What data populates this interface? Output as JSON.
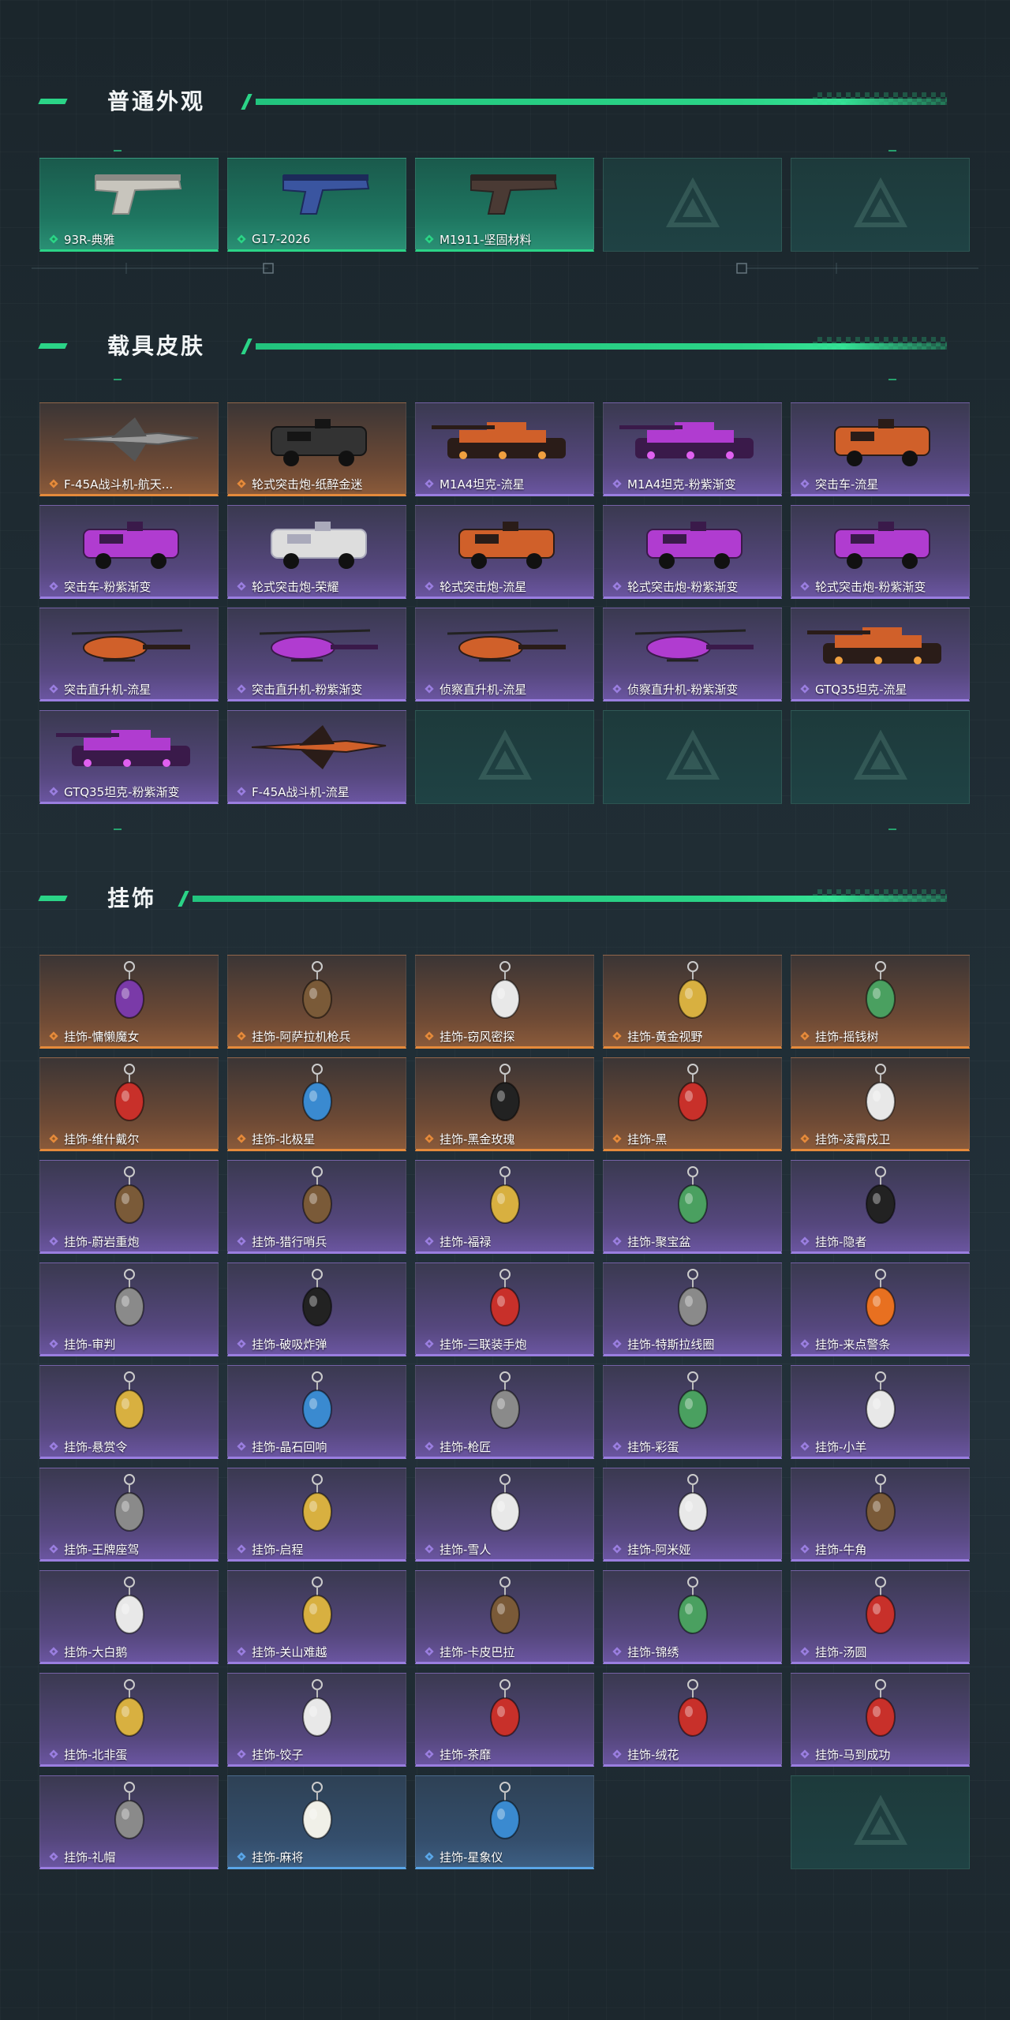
{
  "sections": {
    "weapons": {
      "title": "普通外观",
      "items": [
        {
          "label": "93R-典雅",
          "quality": "green",
          "art": "pistol-silver"
        },
        {
          "label": "G17-2026",
          "quality": "green",
          "art": "pistol-blue"
        },
        {
          "label": "M1911-坚固材料",
          "quality": "green",
          "art": "pistol-dark"
        },
        {
          "label": "",
          "quality": "empty"
        },
        {
          "label": "",
          "quality": "empty"
        }
      ]
    },
    "vehicles": {
      "title": "载具皮肤",
      "items": [
        {
          "label": "F-45A战斗机-航天...",
          "quality": "orange",
          "art": "jet-grey"
        },
        {
          "label": "轮式突击炮-纸醉金迷",
          "quality": "orange",
          "art": "apc-black"
        },
        {
          "label": "M1A4坦克-流星",
          "quality": "purple",
          "art": "tank-lava"
        },
        {
          "label": "M1A4坦克-粉紫渐变",
          "quality": "purple",
          "art": "tank-purple"
        },
        {
          "label": "突击车-流星",
          "quality": "purple",
          "art": "truck-lava"
        },
        {
          "label": "突击车-粉紫渐变",
          "quality": "purple",
          "art": "truck-purple"
        },
        {
          "label": "轮式突击炮-荣耀",
          "quality": "purple",
          "art": "apc-white"
        },
        {
          "label": "轮式突击炮-流星",
          "quality": "purple",
          "art": "apc-lava"
        },
        {
          "label": "轮式突击炮-粉紫渐变",
          "quality": "purple",
          "art": "apc-purple"
        },
        {
          "label": "轮式突击炮-粉紫渐变",
          "quality": "purple",
          "art": "apc-purple"
        },
        {
          "label": "突击直升机-流星",
          "quality": "purple",
          "art": "heli-lava"
        },
        {
          "label": "突击直升机-粉紫渐变",
          "quality": "purple",
          "art": "heli-purple"
        },
        {
          "label": "侦察直升机-流星",
          "quality": "purple",
          "art": "scout-lava"
        },
        {
          "label": "侦察直升机-粉紫渐变",
          "quality": "purple",
          "art": "scout-purple"
        },
        {
          "label": "GTQ35坦克-流星",
          "quality": "purple",
          "art": "tank-lava"
        },
        {
          "label": "GTQ35坦克-粉紫渐变",
          "quality": "purple",
          "art": "tank-purple"
        },
        {
          "label": "F-45A战斗机-流星",
          "quality": "purple",
          "art": "jet-lava"
        },
        {
          "label": "",
          "quality": "empty"
        },
        {
          "label": "",
          "quality": "empty"
        },
        {
          "label": "",
          "quality": "empty"
        }
      ]
    },
    "charms": {
      "title": "挂饰",
      "items": [
        {
          "label": "挂饰-慵懒魔女",
          "quality": "orange",
          "art": "charm-purple"
        },
        {
          "label": "挂饰-阿萨拉机枪兵",
          "quality": "orange",
          "art": "charm-brown"
        },
        {
          "label": "挂饰-窃风密探",
          "quality": "orange",
          "art": "charm-white"
        },
        {
          "label": "挂饰-黄金视野",
          "quality": "orange",
          "art": "charm-gold"
        },
        {
          "label": "挂饰-摇钱树",
          "quality": "orange",
          "art": "charm-green"
        },
        {
          "label": "挂饰-维什戴尔",
          "quality": "orange",
          "art": "charm-red"
        },
        {
          "label": "挂饰-北极星",
          "quality": "orange",
          "art": "charm-blue"
        },
        {
          "label": "挂饰-黑金玫瑰",
          "quality": "orange",
          "art": "charm-black"
        },
        {
          "label": "挂饰-黑",
          "quality": "orange",
          "art": "charm-red"
        },
        {
          "label": "挂饰-凌霄戍卫",
          "quality": "orange",
          "art": "charm-white"
        },
        {
          "label": "挂饰-蔚岩重炮",
          "quality": "purple",
          "art": "charm-brown"
        },
        {
          "label": "挂饰-猎行哨兵",
          "quality": "purple",
          "art": "charm-brown"
        },
        {
          "label": "挂饰-福禄",
          "quality": "purple",
          "art": "charm-gold"
        },
        {
          "label": "挂饰-聚宝盆",
          "quality": "purple",
          "art": "charm-green"
        },
        {
          "label": "挂饰-隐者",
          "quality": "purple",
          "art": "charm-black"
        },
        {
          "label": "挂饰-审判",
          "quality": "purple",
          "art": "charm-grey"
        },
        {
          "label": "挂饰-破吸炸弹",
          "quality": "purple",
          "art": "charm-black"
        },
        {
          "label": "挂饰-三联装手炮",
          "quality": "purple",
          "art": "charm-red"
        },
        {
          "label": "挂饰-特斯拉线圈",
          "quality": "purple",
          "art": "charm-grey"
        },
        {
          "label": "挂饰-来点警条",
          "quality": "purple",
          "art": "charm-orange"
        },
        {
          "label": "挂饰-悬赏令",
          "quality": "purple",
          "art": "charm-gold"
        },
        {
          "label": "挂饰-晶石回响",
          "quality": "purple",
          "art": "charm-blue"
        },
        {
          "label": "挂饰-枪匠",
          "quality": "purple",
          "art": "charm-grey"
        },
        {
          "label": "挂饰-彩蛋",
          "quality": "purple",
          "art": "charm-green"
        },
        {
          "label": "挂饰-小羊",
          "quality": "purple",
          "art": "charm-white"
        },
        {
          "label": "挂饰-王牌座驾",
          "quality": "purple",
          "art": "charm-grey"
        },
        {
          "label": "挂饰-启程",
          "quality": "purple",
          "art": "charm-gold"
        },
        {
          "label": "挂饰-雪人",
          "quality": "purple",
          "art": "charm-white"
        },
        {
          "label": "挂饰-阿米娅",
          "quality": "purple",
          "art": "charm-white"
        },
        {
          "label": "挂饰-牛角",
          "quality": "purple",
          "art": "charm-brown"
        },
        {
          "label": "挂饰-大白鹅",
          "quality": "purple",
          "art": "charm-white"
        },
        {
          "label": "挂饰-关山难越",
          "quality": "purple",
          "art": "charm-gold"
        },
        {
          "label": "挂饰-卡皮巴拉",
          "quality": "purple",
          "art": "charm-brown"
        },
        {
          "label": "挂饰-锦绣",
          "quality": "purple",
          "art": "charm-green"
        },
        {
          "label": "挂饰-汤圆",
          "quality": "purple",
          "art": "charm-red"
        },
        {
          "label": "挂饰-北非蛋",
          "quality": "purple",
          "art": "charm-gold"
        },
        {
          "label": "挂饰-饺子",
          "quality": "purple",
          "art": "charm-white"
        },
        {
          "label": "挂饰-茶靡",
          "quality": "purple",
          "art": "charm-red"
        },
        {
          "label": "挂饰-绒花",
          "quality": "purple",
          "art": "charm-red"
        },
        {
          "label": "挂饰-马到成功",
          "quality": "purple",
          "art": "charm-red"
        },
        {
          "label": "挂饰-礼帽",
          "quality": "purple",
          "art": "charm-grey"
        },
        {
          "label": "挂饰-麻将",
          "quality": "blue",
          "art": "charm-mahjong"
        },
        {
          "label": "挂饰-星象仪",
          "quality": "blue",
          "art": "charm-blue"
        },
        {
          "label": "",
          "quality": "none"
        },
        {
          "label": "",
          "quality": "empty"
        }
      ]
    }
  },
  "colors": {
    "accent": "#2bd487",
    "orange": "#e58a3b",
    "purple": "#9a7ee0",
    "blue": "#5aa6e8",
    "green": "#2bd487"
  }
}
